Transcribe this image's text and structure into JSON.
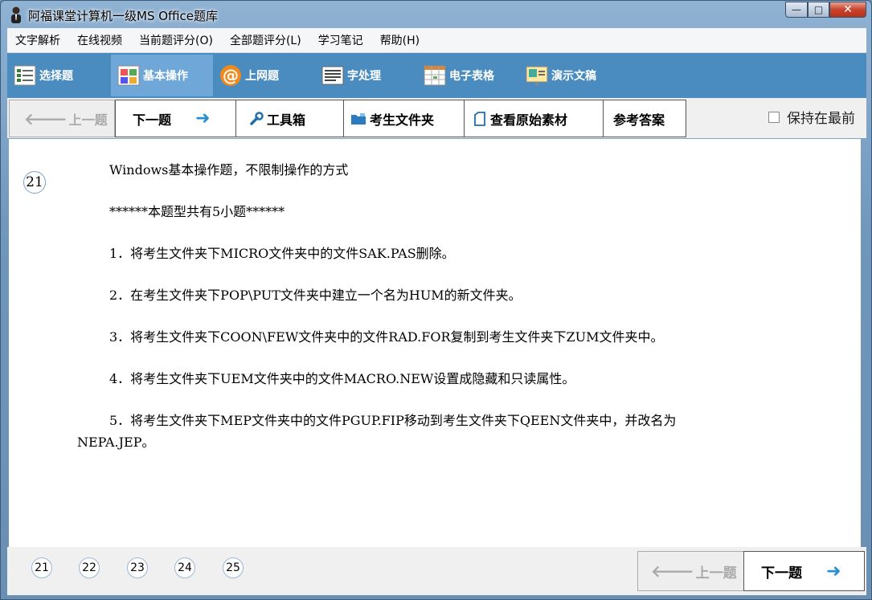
{
  "window": {
    "title": "阿福课堂计算机一级MS Office题库"
  },
  "menu": [
    "文字解析",
    "在线视频",
    "当前题评分(O)",
    "全部题评分(L)",
    "学习笔记",
    "帮助(H)"
  ],
  "modules": {
    "choice": "选择题",
    "basic": "基本操作",
    "internet": "上网题",
    "word": "字处理",
    "excel": "电子表格",
    "ppt": "演示文稿"
  },
  "toolbar": {
    "prev": "上一题",
    "next": "下一题",
    "toolbox": "工具箱",
    "folder": "考生文件夹",
    "material": "查看原始素材",
    "answer": "参考答案",
    "keep_on_top": "保持在最前"
  },
  "question": {
    "number": "21",
    "intro": "Windows基本操作题，不限制操作的方式",
    "count_line": "******本题型共有5小题******",
    "items": [
      "1．将考生文件夹下MICRO文件夹中的文件SAK.PAS删除。",
      "2．在考生文件夹下POP\\PUT文件夹中建立一个名为HUM的新文件夹。",
      "3．将考生文件夹下COON\\FEW文件夹中的文件RAD.FOR复制到考生文件夹下ZUM文件夹中。",
      "4．将考生文件夹下UEM文件夹中的文件MACRO.NEW设置成隐藏和只读属性。",
      "5．将考生文件夹下MEP文件夹中的文件PGUP.FIP移动到考生文件夹下QEEN文件夹中，并改名为"
    ],
    "item5_cont": "NEPA.JEP。"
  },
  "pages": [
    "21",
    "22",
    "23",
    "24",
    "25"
  ],
  "bottom_nav": {
    "prev": "上一题",
    "next": "下一题"
  }
}
